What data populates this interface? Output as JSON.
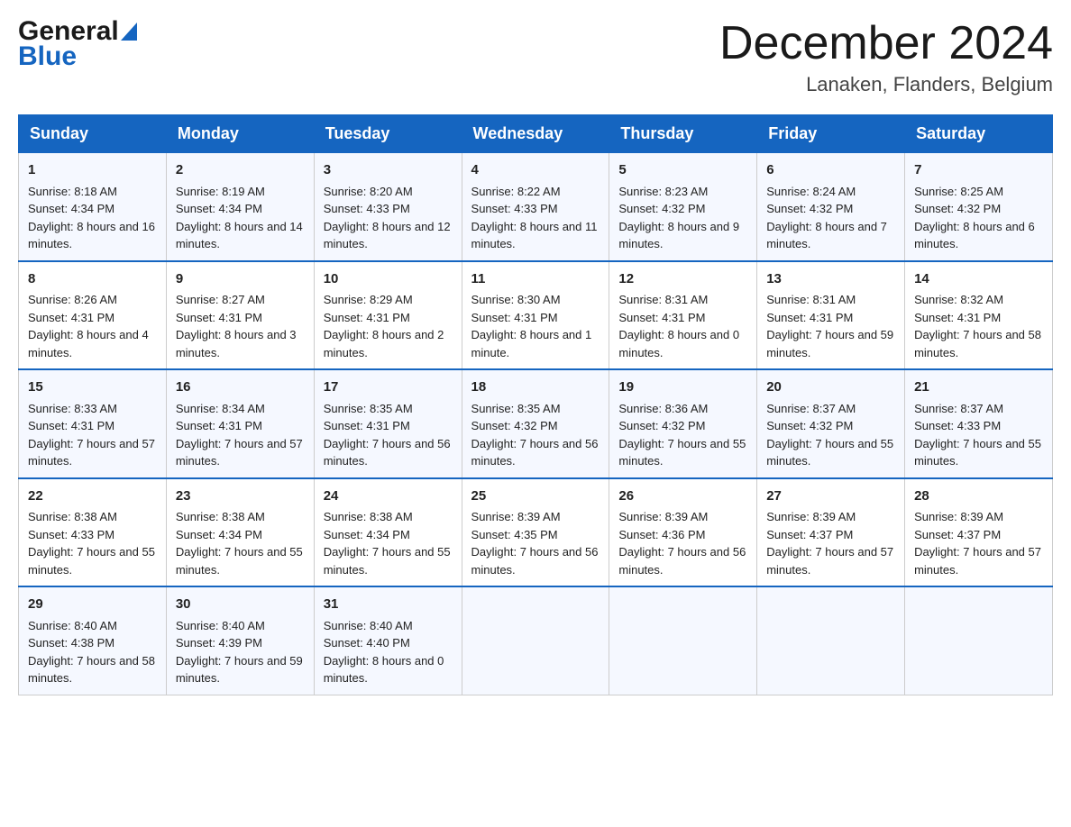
{
  "header": {
    "logo": {
      "general": "General",
      "triangle": "▶",
      "blue": "Blue"
    },
    "title": "December 2024",
    "location": "Lanaken, Flanders, Belgium"
  },
  "days": [
    "Sunday",
    "Monday",
    "Tuesday",
    "Wednesday",
    "Thursday",
    "Friday",
    "Saturday"
  ],
  "weeks": [
    [
      {
        "num": "1",
        "sunrise": "8:18 AM",
        "sunset": "4:34 PM",
        "daylight": "8 hours and 16 minutes."
      },
      {
        "num": "2",
        "sunrise": "8:19 AM",
        "sunset": "4:34 PM",
        "daylight": "8 hours and 14 minutes."
      },
      {
        "num": "3",
        "sunrise": "8:20 AM",
        "sunset": "4:33 PM",
        "daylight": "8 hours and 12 minutes."
      },
      {
        "num": "4",
        "sunrise": "8:22 AM",
        "sunset": "4:33 PM",
        "daylight": "8 hours and 11 minutes."
      },
      {
        "num": "5",
        "sunrise": "8:23 AM",
        "sunset": "4:32 PM",
        "daylight": "8 hours and 9 minutes."
      },
      {
        "num": "6",
        "sunrise": "8:24 AM",
        "sunset": "4:32 PM",
        "daylight": "8 hours and 7 minutes."
      },
      {
        "num": "7",
        "sunrise": "8:25 AM",
        "sunset": "4:32 PM",
        "daylight": "8 hours and 6 minutes."
      }
    ],
    [
      {
        "num": "8",
        "sunrise": "8:26 AM",
        "sunset": "4:31 PM",
        "daylight": "8 hours and 4 minutes."
      },
      {
        "num": "9",
        "sunrise": "8:27 AM",
        "sunset": "4:31 PM",
        "daylight": "8 hours and 3 minutes."
      },
      {
        "num": "10",
        "sunrise": "8:29 AM",
        "sunset": "4:31 PM",
        "daylight": "8 hours and 2 minutes."
      },
      {
        "num": "11",
        "sunrise": "8:30 AM",
        "sunset": "4:31 PM",
        "daylight": "8 hours and 1 minute."
      },
      {
        "num": "12",
        "sunrise": "8:31 AM",
        "sunset": "4:31 PM",
        "daylight": "8 hours and 0 minutes."
      },
      {
        "num": "13",
        "sunrise": "8:31 AM",
        "sunset": "4:31 PM",
        "daylight": "7 hours and 59 minutes."
      },
      {
        "num": "14",
        "sunrise": "8:32 AM",
        "sunset": "4:31 PM",
        "daylight": "7 hours and 58 minutes."
      }
    ],
    [
      {
        "num": "15",
        "sunrise": "8:33 AM",
        "sunset": "4:31 PM",
        "daylight": "7 hours and 57 minutes."
      },
      {
        "num": "16",
        "sunrise": "8:34 AM",
        "sunset": "4:31 PM",
        "daylight": "7 hours and 57 minutes."
      },
      {
        "num": "17",
        "sunrise": "8:35 AM",
        "sunset": "4:31 PM",
        "daylight": "7 hours and 56 minutes."
      },
      {
        "num": "18",
        "sunrise": "8:35 AM",
        "sunset": "4:32 PM",
        "daylight": "7 hours and 56 minutes."
      },
      {
        "num": "19",
        "sunrise": "8:36 AM",
        "sunset": "4:32 PM",
        "daylight": "7 hours and 55 minutes."
      },
      {
        "num": "20",
        "sunrise": "8:37 AM",
        "sunset": "4:32 PM",
        "daylight": "7 hours and 55 minutes."
      },
      {
        "num": "21",
        "sunrise": "8:37 AM",
        "sunset": "4:33 PM",
        "daylight": "7 hours and 55 minutes."
      }
    ],
    [
      {
        "num": "22",
        "sunrise": "8:38 AM",
        "sunset": "4:33 PM",
        "daylight": "7 hours and 55 minutes."
      },
      {
        "num": "23",
        "sunrise": "8:38 AM",
        "sunset": "4:34 PM",
        "daylight": "7 hours and 55 minutes."
      },
      {
        "num": "24",
        "sunrise": "8:38 AM",
        "sunset": "4:34 PM",
        "daylight": "7 hours and 55 minutes."
      },
      {
        "num": "25",
        "sunrise": "8:39 AM",
        "sunset": "4:35 PM",
        "daylight": "7 hours and 56 minutes."
      },
      {
        "num": "26",
        "sunrise": "8:39 AM",
        "sunset": "4:36 PM",
        "daylight": "7 hours and 56 minutes."
      },
      {
        "num": "27",
        "sunrise": "8:39 AM",
        "sunset": "4:37 PM",
        "daylight": "7 hours and 57 minutes."
      },
      {
        "num": "28",
        "sunrise": "8:39 AM",
        "sunset": "4:37 PM",
        "daylight": "7 hours and 57 minutes."
      }
    ],
    [
      {
        "num": "29",
        "sunrise": "8:40 AM",
        "sunset": "4:38 PM",
        "daylight": "7 hours and 58 minutes."
      },
      {
        "num": "30",
        "sunrise": "8:40 AM",
        "sunset": "4:39 PM",
        "daylight": "7 hours and 59 minutes."
      },
      {
        "num": "31",
        "sunrise": "8:40 AM",
        "sunset": "4:40 PM",
        "daylight": "8 hours and 0 minutes."
      },
      null,
      null,
      null,
      null
    ]
  ]
}
